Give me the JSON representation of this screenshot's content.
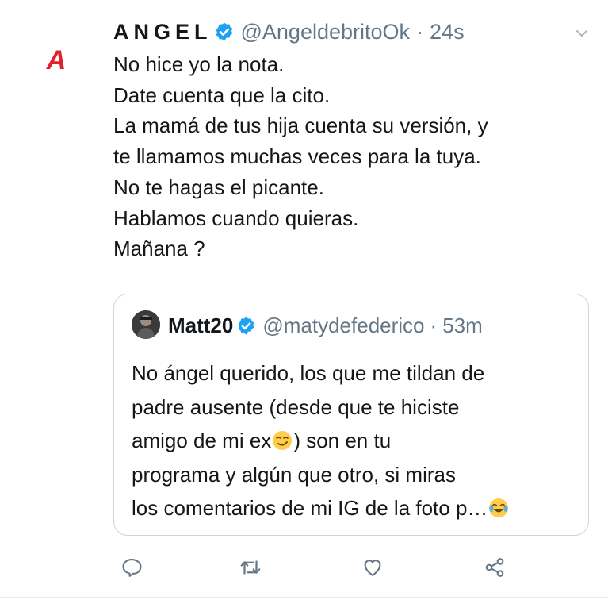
{
  "tweet": {
    "author": {
      "display_name": "ANGEL",
      "handle": "@AngeldebritoOk",
      "verified": true,
      "avatar_letter": "A"
    },
    "separator": "·",
    "time": "24s",
    "lines": [
      "No hice yo la nota.",
      "Date cuenta que la cito.",
      "La mamá de tus hija cuenta su versión, y",
      "te llamamos muchas veces para la tuya.",
      "No te hagas el picante.",
      "Hablamos cuando quieras.",
      "Mañana ?"
    ]
  },
  "quoted": {
    "author": {
      "display_name": "Matt20",
      "handle": "@matydefederico",
      "verified": true
    },
    "separator": "·",
    "time": "53m",
    "lines": {
      "l1": "No ángel querido, los que me tildan de",
      "l2": "padre ausente (desde que te hiciste",
      "l3_before": "amigo de mi ex",
      "l3_after": ") son en tu",
      "l4": "programa y algún que otro, si miras",
      "l5": "los comentarios de mi IG de la foto p…"
    },
    "emojis": [
      "smirking-face-emoji",
      "tears-of-joy-emoji"
    ]
  },
  "actions": [
    "reply-icon",
    "retweet-icon",
    "like-icon",
    "share-icon"
  ],
  "colors": {
    "text": "#14171a",
    "secondary": "#657786",
    "verified": "#1da1f2",
    "avatar_brand": "#e0202a",
    "border": "#ccd6dd"
  }
}
